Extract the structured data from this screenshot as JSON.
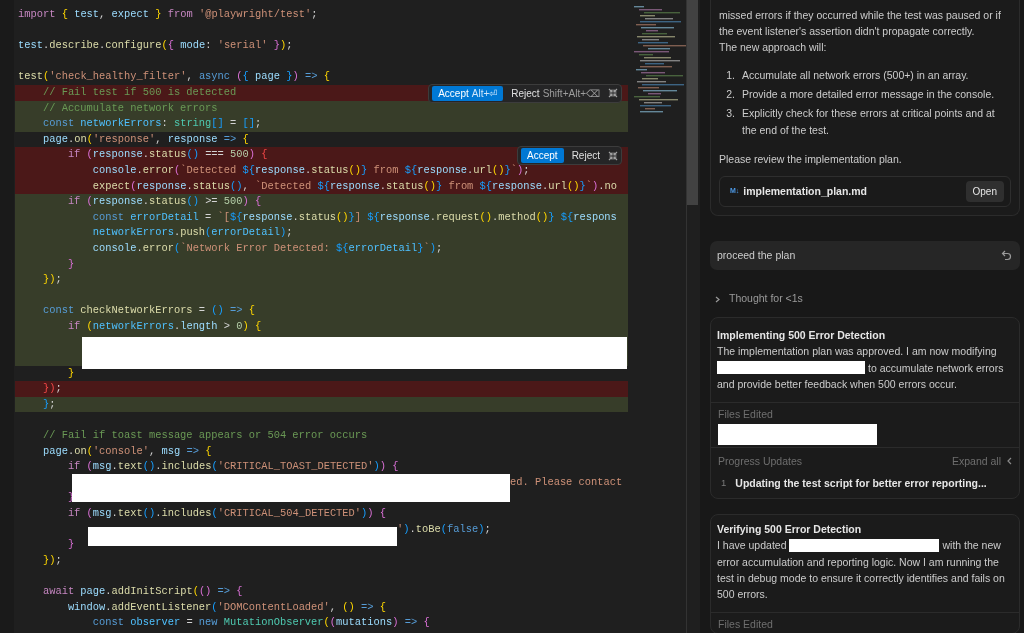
{
  "editor": {
    "lines": [
      {
        "added": false,
        "removed": false,
        "segments": [
          {
            "kind": "code",
            "tokens": [
              {
                "kind": "keyword",
                "text": "import "
              },
              {
                "kind": "bracket1",
                "text": "{ "
              },
              {
                "kind": "variable",
                "text": "test"
              },
              {
                "kind": "plain",
                "text": ", "
              },
              {
                "kind": "variable",
                "text": "expect "
              },
              {
                "kind": "bracket1",
                "text": "} "
              },
              {
                "kind": "keyword",
                "text": "from "
              },
              {
                "kind": "string",
                "text": "'@playwright/test'"
              },
              {
                "kind": "plain",
                "text": ";"
              }
            ]
          }
        ]
      },
      {
        "added": false,
        "removed": false
      },
      {
        "added": false,
        "removed": false,
        "segments": [
          {
            "kind": "code",
            "tokens": [
              {
                "kind": "variable",
                "text": "test"
              },
              {
                "kind": "plain",
                "text": "."
              },
              {
                "kind": "function",
                "text": "describe"
              },
              {
                "kind": "plain",
                "text": "."
              },
              {
                "kind": "function",
                "text": "configure"
              },
              {
                "kind": "bracket1",
                "text": "("
              },
              {
                "kind": "bracket2",
                "text": "{ "
              },
              {
                "kind": "variable",
                "text": "mode"
              },
              {
                "kind": "plain",
                "text": ": "
              },
              {
                "kind": "string",
                "text": "'serial' "
              },
              {
                "kind": "bracket2",
                "text": "}"
              },
              {
                "kind": "bracket1",
                "text": ")"
              },
              {
                "kind": "plain",
                "text": ";"
              }
            ]
          }
        ]
      },
      {
        "added": false,
        "removed": false
      },
      {
        "added": false,
        "removed": false,
        "segments": [
          {
            "kind": "code",
            "tokens": [
              {
                "kind": "function",
                "text": "test"
              },
              {
                "kind": "bracket1",
                "text": "("
              },
              {
                "kind": "string",
                "text": "'check_healthy_filter'"
              },
              {
                "kind": "plain",
                "text": ", "
              },
              {
                "kind": "storage",
                "text": "async "
              },
              {
                "kind": "bracket2",
                "text": "("
              },
              {
                "kind": "bracket3",
                "text": "{ "
              },
              {
                "kind": "variable",
                "text": "page "
              },
              {
                "kind": "bracket3",
                "text": "}"
              },
              {
                "kind": "bracket2",
                "text": ")"
              },
              {
                "kind": "storage",
                "text": " => "
              },
              {
                "kind": "bracket1",
                "text": "{"
              }
            ]
          }
        ]
      },
      {
        "added": false,
        "removed": true,
        "actions": {
          "accept": "Accept",
          "accept_shortcut": "Alt+⏎",
          "reject": "Reject",
          "reject_shortcut": "Shift+Alt+⌫"
        },
        "segments": [
          {
            "kind": "code",
            "tokens": [
              {
                "kind": "comment",
                "text": "    // Fail test if 500 is detected"
              }
            ]
          }
        ]
      },
      {
        "added": true,
        "removed": false,
        "segments": [
          {
            "kind": "code",
            "tokens": [
              {
                "kind": "comment",
                "text": "    // Accumulate network errors"
              }
            ]
          }
        ]
      },
      {
        "added": true,
        "removed": false,
        "segments": [
          {
            "kind": "code",
            "tokens": [
              {
                "kind": "storage",
                "text": "    const "
              },
              {
                "kind": "constant",
                "text": "networkErrors"
              },
              {
                "kind": "plain",
                "text": ": "
              },
              {
                "kind": "type",
                "text": "string"
              },
              {
                "kind": "bracket3",
                "text": "[]"
              },
              {
                "kind": "plain",
                "text": " = "
              },
              {
                "kind": "bracket3",
                "text": "[]"
              },
              {
                "kind": "plain",
                "text": ";"
              }
            ]
          }
        ]
      },
      {
        "added": false,
        "removed": false,
        "segments": [
          {
            "kind": "code",
            "tokens": [
              {
                "kind": "variable",
                "text": "    page"
              },
              {
                "kind": "plain",
                "text": "."
              },
              {
                "kind": "function",
                "text": "on"
              },
              {
                "kind": "bracket1",
                "text": "("
              },
              {
                "kind": "string",
                "text": "'response'"
              },
              {
                "kind": "plain",
                "text": ", "
              },
              {
                "kind": "variable",
                "text": "response"
              },
              {
                "kind": "storage",
                "text": " => "
              },
              {
                "kind": "bracket1",
                "text": "{"
              }
            ]
          }
        ]
      },
      {
        "added": false,
        "removed": true,
        "actions": {
          "accept": "Accept",
          "reject": "Reject"
        },
        "segments": [
          {
            "kind": "code",
            "tokens": [
              {
                "kind": "keyword",
                "text": "        if "
              },
              {
                "kind": "bracket2",
                "text": "("
              },
              {
                "kind": "variable",
                "text": "response"
              },
              {
                "kind": "plain",
                "text": "."
              },
              {
                "kind": "function",
                "text": "status"
              },
              {
                "kind": "bracket3",
                "text": "()"
              },
              {
                "kind": "plain",
                "text": " === "
              },
              {
                "kind": "number",
                "text": "500"
              },
              {
                "kind": "bracket2",
                "text": ")"
              },
              {
                "kind": "error",
                "text": " {"
              }
            ]
          }
        ]
      },
      {
        "added": false,
        "removed": true,
        "segments": [
          {
            "kind": "code",
            "tokens": [
              {
                "kind": "variable",
                "text": "            console"
              },
              {
                "kind": "plain",
                "text": "."
              },
              {
                "kind": "function",
                "text": "error"
              },
              {
                "kind": "bracket2",
                "text": "("
              },
              {
                "kind": "string",
                "text": "`Detected "
              },
              {
                "kind": "bracket3",
                "text": "${"
              },
              {
                "kind": "variable",
                "text": "response"
              },
              {
                "kind": "plain",
                "text": "."
              },
              {
                "kind": "function",
                "text": "status"
              },
              {
                "kind": "bracket1",
                "text": "()"
              },
              {
                "kind": "bracket3",
                "text": "}"
              },
              {
                "kind": "string",
                "text": " from "
              },
              {
                "kind": "bracket3",
                "text": "${"
              },
              {
                "kind": "variable",
                "text": "response"
              },
              {
                "kind": "plain",
                "text": "."
              },
              {
                "kind": "function",
                "text": "url"
              },
              {
                "kind": "bracket1",
                "text": "()"
              },
              {
                "kind": "bracket3",
                "text": "}"
              },
              {
                "kind": "string",
                "text": "`"
              },
              {
                "kind": "bracket2",
                "text": ")"
              },
              {
                "kind": "plain",
                "text": ";"
              }
            ]
          }
        ]
      },
      {
        "added": false,
        "removed": true,
        "segments": [
          {
            "kind": "code",
            "tokens": [
              {
                "kind": "function",
                "text": "            expect"
              },
              {
                "kind": "bracket2",
                "text": "("
              },
              {
                "kind": "variable",
                "text": "response"
              },
              {
                "kind": "plain",
                "text": "."
              },
              {
                "kind": "function",
                "text": "status"
              },
              {
                "kind": "bracket3",
                "text": "()"
              },
              {
                "kind": "plain",
                "text": ", "
              },
              {
                "kind": "string",
                "text": "`Detected "
              },
              {
                "kind": "bracket3",
                "text": "${"
              },
              {
                "kind": "variable",
                "text": "response"
              },
              {
                "kind": "plain",
                "text": "."
              },
              {
                "kind": "function",
                "text": "status"
              },
              {
                "kind": "bracket1",
                "text": "()"
              },
              {
                "kind": "bracket3",
                "text": "}"
              },
              {
                "kind": "string",
                "text": " from "
              },
              {
                "kind": "bracket3",
                "text": "${"
              },
              {
                "kind": "variable",
                "text": "response"
              },
              {
                "kind": "plain",
                "text": "."
              },
              {
                "kind": "function",
                "text": "url"
              },
              {
                "kind": "bracket1",
                "text": "()"
              },
              {
                "kind": "bracket3",
                "text": "}"
              },
              {
                "kind": "string",
                "text": "`"
              },
              {
                "kind": "bracket2",
                "text": ")"
              },
              {
                "kind": "plain",
                "text": "."
              },
              {
                "kind": "function",
                "text": "no"
              }
            ]
          }
        ]
      },
      {
        "added": true,
        "removed": false,
        "segments": [
          {
            "kind": "code",
            "tokens": [
              {
                "kind": "keyword",
                "text": "        if "
              },
              {
                "kind": "bracket2",
                "text": "("
              },
              {
                "kind": "variable",
                "text": "response"
              },
              {
                "kind": "plain",
                "text": "."
              },
              {
                "kind": "function",
                "text": "status"
              },
              {
                "kind": "bracket3",
                "text": "()"
              },
              {
                "kind": "plain",
                "text": " >= "
              },
              {
                "kind": "number",
                "text": "500"
              },
              {
                "kind": "bracket2",
                "text": ")"
              },
              {
                "kind": "bracket2",
                "text": " {"
              }
            ]
          }
        ]
      },
      {
        "added": true,
        "removed": false,
        "segments": [
          {
            "kind": "code",
            "tokens": [
              {
                "kind": "storage",
                "text": "            const "
              },
              {
                "kind": "constant",
                "text": "errorDetail"
              },
              {
                "kind": "plain",
                "text": " = "
              },
              {
                "kind": "string",
                "text": "`["
              },
              {
                "kind": "bracket3",
                "text": "${"
              },
              {
                "kind": "variable",
                "text": "response"
              },
              {
                "kind": "plain",
                "text": "."
              },
              {
                "kind": "function",
                "text": "status"
              },
              {
                "kind": "bracket1",
                "text": "()"
              },
              {
                "kind": "bracket3",
                "text": "}"
              },
              {
                "kind": "string",
                "text": "] "
              },
              {
                "kind": "bracket3",
                "text": "${"
              },
              {
                "kind": "variable",
                "text": "response"
              },
              {
                "kind": "plain",
                "text": "."
              },
              {
                "kind": "function",
                "text": "request"
              },
              {
                "kind": "bracket1",
                "text": "()"
              },
              {
                "kind": "plain",
                "text": "."
              },
              {
                "kind": "function",
                "text": "method"
              },
              {
                "kind": "bracket1",
                "text": "()"
              },
              {
                "kind": "bracket3",
                "text": "} ${"
              },
              {
                "kind": "variable",
                "text": "respons"
              }
            ]
          }
        ]
      },
      {
        "added": true,
        "removed": false,
        "segments": [
          {
            "kind": "code",
            "tokens": [
              {
                "kind": "constant",
                "text": "            networkErrors"
              },
              {
                "kind": "plain",
                "text": "."
              },
              {
                "kind": "function",
                "text": "push"
              },
              {
                "kind": "bracket3",
                "text": "("
              },
              {
                "kind": "constant",
                "text": "errorDetail"
              },
              {
                "kind": "bracket3",
                "text": ")"
              },
              {
                "kind": "plain",
                "text": ";"
              }
            ]
          }
        ]
      },
      {
        "added": true,
        "removed": false,
        "segments": [
          {
            "kind": "code",
            "tokens": [
              {
                "kind": "variable",
                "text": "            console"
              },
              {
                "kind": "plain",
                "text": "."
              },
              {
                "kind": "function",
                "text": "error"
              },
              {
                "kind": "bracket3",
                "text": "("
              },
              {
                "kind": "string",
                "text": "`Network Error Detected: "
              },
              {
                "kind": "bracket3",
                "text": "${"
              },
              {
                "kind": "constant",
                "text": "errorDetail"
              },
              {
                "kind": "bracket3",
                "text": "}"
              },
              {
                "kind": "string",
                "text": "`"
              },
              {
                "kind": "bracket3",
                "text": ")"
              },
              {
                "kind": "plain",
                "text": ";"
              }
            ]
          }
        ]
      },
      {
        "added": true,
        "removed": false,
        "segments": [
          {
            "kind": "code",
            "tokens": [
              {
                "kind": "bracket2",
                "text": "        }"
              }
            ]
          }
        ]
      },
      {
        "added": true,
        "removed": false,
        "segments": [
          {
            "kind": "code",
            "tokens": [
              {
                "kind": "bracket1",
                "text": "    })"
              },
              {
                "kind": "plain",
                "text": ";"
              }
            ]
          }
        ]
      },
      {
        "added": true,
        "removed": false
      },
      {
        "added": true,
        "removed": false,
        "segments": [
          {
            "kind": "code",
            "tokens": [
              {
                "kind": "storage",
                "text": "    const "
              },
              {
                "kind": "function",
                "text": "checkNetworkErrors"
              },
              {
                "kind": "plain",
                "text": " = "
              },
              {
                "kind": "bracket3",
                "text": "() "
              },
              {
                "kind": "storage",
                "text": "=> "
              },
              {
                "kind": "bracket1",
                "text": "{"
              }
            ]
          }
        ]
      },
      {
        "added": true,
        "removed": false,
        "segments": [
          {
            "kind": "code",
            "tokens": [
              {
                "kind": "keyword",
                "text": "        if "
              },
              {
                "kind": "bracket1",
                "text": "("
              },
              {
                "kind": "constant",
                "text": "networkErrors"
              },
              {
                "kind": "plain",
                "text": "."
              },
              {
                "kind": "variable",
                "text": "length"
              },
              {
                "kind": "plain",
                "text": " > "
              },
              {
                "kind": "number",
                "text": "0"
              },
              {
                "kind": "bracket1",
                "text": ")"
              },
              {
                "kind": "bracket1",
                "text": " {"
              }
            ]
          }
        ]
      },
      {
        "added": true,
        "removed": false,
        "segments": [
          {
            "kind": "redaction"
          }
        ]
      },
      {
        "added": true,
        "removed": false
      },
      {
        "added": false,
        "removed": false,
        "segments": [
          {
            "kind": "code",
            "tokens": [
              {
                "kind": "bracket1",
                "text": "        }"
              }
            ]
          }
        ]
      },
      {
        "added": false,
        "removed": true,
        "segments": [
          {
            "kind": "code",
            "tokens": [
              {
                "kind": "error",
                "text": "    })"
              },
              {
                "kind": "plain",
                "text": ";"
              }
            ]
          }
        ]
      },
      {
        "added": true,
        "removed": false,
        "segments": [
          {
            "kind": "code",
            "tokens": [
              {
                "kind": "bracket3",
                "text": "    }"
              },
              {
                "kind": "plain",
                "text": ";"
              }
            ]
          }
        ]
      },
      {
        "added": false,
        "removed": false
      },
      {
        "added": false,
        "removed": false,
        "segments": [
          {
            "kind": "code",
            "tokens": [
              {
                "kind": "comment",
                "text": "    // Fail if toast message appears or 504 error occurs"
              }
            ]
          }
        ]
      },
      {
        "added": false,
        "removed": false,
        "segments": [
          {
            "kind": "code",
            "tokens": [
              {
                "kind": "variable",
                "text": "    page"
              },
              {
                "kind": "plain",
                "text": "."
              },
              {
                "kind": "function",
                "text": "on"
              },
              {
                "kind": "bracket1",
                "text": "("
              },
              {
                "kind": "string",
                "text": "'console'"
              },
              {
                "kind": "plain",
                "text": ", "
              },
              {
                "kind": "variable",
                "text": "msg"
              },
              {
                "kind": "storage",
                "text": " => "
              },
              {
                "kind": "bracket1",
                "text": "{"
              }
            ]
          }
        ]
      },
      {
        "added": false,
        "removed": false,
        "segments": [
          {
            "kind": "code",
            "tokens": [
              {
                "kind": "keyword",
                "text": "        if "
              },
              {
                "kind": "bracket2",
                "text": "("
              },
              {
                "kind": "variable",
                "text": "msg"
              },
              {
                "kind": "plain",
                "text": "."
              },
              {
                "kind": "function",
                "text": "text"
              },
              {
                "kind": "bracket3",
                "text": "()"
              },
              {
                "kind": "plain",
                "text": "."
              },
              {
                "kind": "function",
                "text": "includes"
              },
              {
                "kind": "bracket3",
                "text": "("
              },
              {
                "kind": "string",
                "text": "'CRITICAL_TOAST_DETECTED'"
              },
              {
                "kind": "bracket3",
                "text": ")"
              },
              {
                "kind": "bracket2",
                "text": ")"
              },
              {
                "kind": "bracket2",
                "text": " {"
              }
            ]
          }
        ]
      },
      {
        "added": false,
        "removed": false,
        "segments": [
          {
            "kind": "redaction"
          },
          {
            "kind": "code",
            "tokens": [
              {
                "kind": "string",
                "text": "ed. Please contact"
              }
            ]
          }
        ]
      },
      {
        "added": false,
        "removed": false,
        "segments": [
          {
            "kind": "code",
            "tokens": [
              {
                "kind": "bracket2",
                "text": "        }"
              }
            ]
          }
        ]
      },
      {
        "added": false,
        "removed": false,
        "segments": [
          {
            "kind": "code",
            "tokens": [
              {
                "kind": "keyword",
                "text": "        if "
              },
              {
                "kind": "bracket2",
                "text": "("
              },
              {
                "kind": "variable",
                "text": "msg"
              },
              {
                "kind": "plain",
                "text": "."
              },
              {
                "kind": "function",
                "text": "text"
              },
              {
                "kind": "bracket3",
                "text": "()"
              },
              {
                "kind": "plain",
                "text": "."
              },
              {
                "kind": "function",
                "text": "includes"
              },
              {
                "kind": "bracket3",
                "text": "("
              },
              {
                "kind": "string",
                "text": "'CRITICAL_504_DETECTED'"
              },
              {
                "kind": "bracket3",
                "text": ")"
              },
              {
                "kind": "bracket2",
                "text": ")"
              },
              {
                "kind": "bracket2",
                "text": " {"
              }
            ]
          }
        ]
      },
      {
        "added": false,
        "removed": false,
        "segments": [
          {
            "kind": "redaction"
          },
          {
            "kind": "code",
            "tokens": [
              {
                "kind": "string",
                "text": "'"
              },
              {
                "kind": "bracket3",
                "text": ")"
              },
              {
                "kind": "plain",
                "text": "."
              },
              {
                "kind": "function",
                "text": "toBe"
              },
              {
                "kind": "bracket3",
                "text": "("
              },
              {
                "kind": "storage",
                "text": "false"
              },
              {
                "kind": "bracket3",
                "text": ")"
              },
              {
                "kind": "plain",
                "text": ";"
              }
            ]
          }
        ]
      },
      {
        "added": false,
        "removed": false,
        "segments": [
          {
            "kind": "code",
            "tokens": [
              {
                "kind": "bracket2",
                "text": "        }"
              }
            ]
          }
        ]
      },
      {
        "added": false,
        "removed": false,
        "segments": [
          {
            "kind": "code",
            "tokens": [
              {
                "kind": "bracket1",
                "text": "    })"
              },
              {
                "kind": "plain",
                "text": ";"
              }
            ]
          }
        ]
      },
      {
        "added": false,
        "removed": false
      },
      {
        "added": false,
        "removed": false,
        "segments": [
          {
            "kind": "code",
            "tokens": [
              {
                "kind": "keyword",
                "text": "    await "
              },
              {
                "kind": "variable",
                "text": "page"
              },
              {
                "kind": "plain",
                "text": "."
              },
              {
                "kind": "function",
                "text": "addInitScript"
              },
              {
                "kind": "bracket1",
                "text": "("
              },
              {
                "kind": "bracket2",
                "text": "() "
              },
              {
                "kind": "storage",
                "text": "=> "
              },
              {
                "kind": "bracket2",
                "text": "{"
              }
            ]
          }
        ]
      },
      {
        "added": false,
        "removed": false,
        "segments": [
          {
            "kind": "code",
            "tokens": [
              {
                "kind": "variable",
                "text": "        window"
              },
              {
                "kind": "plain",
                "text": "."
              },
              {
                "kind": "function",
                "text": "addEventListener"
              },
              {
                "kind": "bracket3",
                "text": "("
              },
              {
                "kind": "string",
                "text": "'DOMContentLoaded'"
              },
              {
                "kind": "plain",
                "text": ", "
              },
              {
                "kind": "bracket1",
                "text": "() "
              },
              {
                "kind": "storage",
                "text": "=> "
              },
              {
                "kind": "bracket1",
                "text": "{"
              }
            ]
          }
        ]
      },
      {
        "added": false,
        "removed": false,
        "segments": [
          {
            "kind": "code",
            "tokens": [
              {
                "kind": "storage",
                "text": "            const "
              },
              {
                "kind": "constant",
                "text": "observer"
              },
              {
                "kind": "plain",
                "text": " = "
              },
              {
                "kind": "storage",
                "text": "new "
              },
              {
                "kind": "type",
                "text": "MutationObserver"
              },
              {
                "kind": "bracket1",
                "text": "("
              },
              {
                "kind": "bracket2",
                "text": "("
              },
              {
                "kind": "variable",
                "text": "mutations"
              },
              {
                "kind": "bracket2",
                "text": ")"
              },
              {
                "kind": "storage",
                "text": " => "
              },
              {
                "kind": "bracket2",
                "text": "{"
              }
            ]
          }
        ]
      }
    ]
  },
  "chat": {
    "plan_card": {
      "paragraph": "missed errors if they occurred while the test was paused or if the event listener's assertion didn't propagate correctly.",
      "intro": "The new approach will:",
      "steps": [
        {
          "number": "1.",
          "text": "Accumulate all network errors (500+) in an array."
        },
        {
          "number": "2.",
          "text": "Provide a more detailed error message in the console."
        },
        {
          "number": "3.",
          "text": "Explicitly check for these errors at critical points and at the end of the test."
        }
      ],
      "review": "Please review the implementation plan.",
      "file": {
        "badge": "M↓",
        "name": "implementation_plan.md",
        "action": "Open"
      }
    },
    "user_message": {
      "text": "proceed the plan"
    },
    "thought": {
      "label": "Thought for <1s",
      "expanded": false
    },
    "tasks": [
      {
        "title": "Implementing 500 Error Detection",
        "body_before": "The implementation plan was approved. I am now modifying",
        "body_after": "to accumulate network errors",
        "body_rest": "and provide better feedback when 500 errors occur.",
        "files_label": "Files Edited",
        "progress": {
          "label": "Progress Updates",
          "action": "Expand all",
          "items": [
            {
              "number": "1",
              "text": "Updating the test script for better error reporting..."
            }
          ]
        }
      },
      {
        "title": "Verifying 500 Error Detection",
        "body_before": "I have updated",
        "body_after": "with the new",
        "body_rest": "error accumulation and reporting logic. Now I am running the test in debug mode to ensure it correctly identifies and fails on 500 errors.",
        "files_label": "Files Edited"
      }
    ]
  }
}
